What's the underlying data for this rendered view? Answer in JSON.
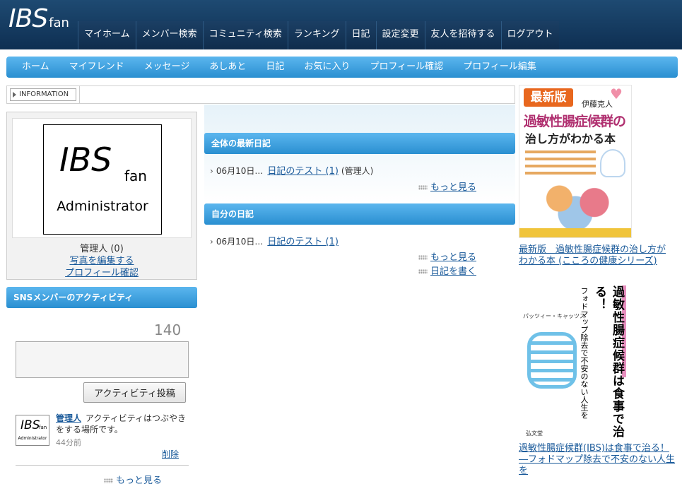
{
  "header": {
    "logo_main": "IBS",
    "logo_sub": "fan",
    "nav": [
      {
        "label": "マイホーム"
      },
      {
        "label": "メンバー検索"
      },
      {
        "label": "コミュニティ検索"
      },
      {
        "label": "ランキング"
      },
      {
        "label": "日記"
      },
      {
        "label": "設定変更"
      },
      {
        "label": "友人を招待する"
      },
      {
        "label": "ログアウト"
      }
    ]
  },
  "subnav": [
    {
      "label": "ホーム"
    },
    {
      "label": "マイフレンド"
    },
    {
      "label": "メッセージ"
    },
    {
      "label": "あしあと"
    },
    {
      "label": "日記"
    },
    {
      "label": "お気に入り"
    },
    {
      "label": "プロフィール確認"
    },
    {
      "label": "プロフィール編集"
    }
  ],
  "info": {
    "label": "INFORMATION"
  },
  "profile": {
    "logo_main": "IBS",
    "logo_sub": "fan",
    "logo_role": "Administrator",
    "name": "管理人 (0)",
    "edit_photo": "写真を編集する",
    "confirm_profile": "プロフィール確認"
  },
  "activity": {
    "heading": "SNSメンバーのアクティビティ",
    "counter": "140",
    "post_button": "アクティビティ投稿",
    "item": {
      "avatar_main": "IBS",
      "avatar_sub": "fan",
      "avatar_role": "Administrator",
      "user": "管理人",
      "text": "アクティビティはつぶやきをする場所です。",
      "time": "44分前",
      "delete": "削除"
    },
    "more": "もっと見る"
  },
  "diary_all": {
    "heading": "全体の最新日記",
    "rows": [
      {
        "date": "06月10日…",
        "title": "日記のテスト (1)",
        "by": "(管理人)"
      }
    ],
    "more": "もっと見る"
  },
  "diary_mine": {
    "heading": "自分の日記",
    "rows": [
      {
        "date": "06月10日…",
        "title": "日記のテスト (1)"
      }
    ],
    "more": "もっと見る",
    "write": "日記を書く"
  },
  "ads": {
    "book1": {
      "badge": "最新版",
      "author": "伊藤克人",
      "cover_title1": "過敏性腸症候群の",
      "cover_title2": "治し方がわかる本",
      "link": "最新版　過敏性腸症候群の治し方がわかる本 (こころの健康シリーズ)"
    },
    "book2": {
      "cover_title": "過敏性腸症候群は食事で治る！",
      "cover_sub": "フォドマップ除去で不安のない人生を",
      "author": "パッツィー・キャッツス",
      "publisher": "弘文堂",
      "link": "過敏性腸症候群(IBS)は食事で治る！ ―フォドマップ除去で不安のない人生を"
    }
  },
  "colors": {
    "header_bg": "#0e2f52",
    "accent_blue": "#2a8fd1",
    "link": "#1a5a9a"
  }
}
